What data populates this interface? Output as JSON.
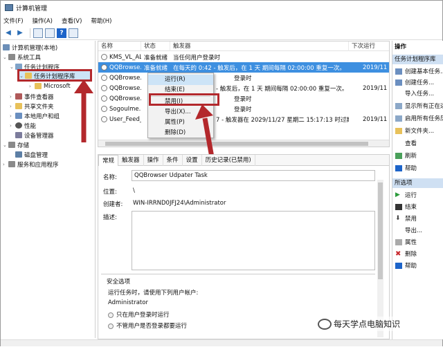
{
  "window": {
    "title": "计算机管理"
  },
  "menu": [
    "文件(F)",
    "操作(A)",
    "查看(V)",
    "帮助(H)"
  ],
  "tree": {
    "root": "计算机管理(本地)",
    "system_tools": "系统工具",
    "task_scheduler": "任务计划程序",
    "task_library": "任务计划程序库",
    "microsoft": "Microsoft",
    "event_viewer": "事件查看器",
    "shared_folders": "共享文件夹",
    "local_users": "本地用户和组",
    "performance": "性能",
    "device_manager": "设备管理器",
    "storage": "存储",
    "disk_mgmt": "磁盘管理",
    "services": "服务和应用程序"
  },
  "list": {
    "columns": [
      "名称",
      "状态",
      "触发器",
      "下次运行"
    ],
    "rows": [
      {
        "name": "KMS_VL_ALL",
        "status": "准备就绪",
        "trigger": "当任何用户登录时",
        "next": ""
      },
      {
        "name": "QQBrowse...",
        "status": "准备就绪",
        "trigger": "在每天的 0:42 - 触发后，在 1 天 期间每隔 02:00:00 重复一次。",
        "next": "2019/11"
      },
      {
        "name": "QQBrowse...",
        "status": "",
        "trigger": "登录时",
        "next": ""
      },
      {
        "name": "QQBrowse...",
        "status": "",
        "trigger": "- 触发后，在 1 天 期间每隔 02:00:00 重复一次。",
        "next": "2019/11"
      },
      {
        "name": "QQBrowse...",
        "status": "",
        "trigger": "登录时",
        "next": ""
      },
      {
        "name": "SogouIme...",
        "status": "",
        "trigger": "登录时",
        "next": ""
      },
      {
        "name": "User_Feed_...",
        "status": "",
        "trigger": "7 - 触发器在 2029/11/27 星期二 15:17:13 时过期。",
        "next": "2019/11"
      }
    ]
  },
  "context_menu": [
    "运行(R)",
    "结束(E)",
    "禁用(I)",
    "导出(X)...",
    "属性(P)",
    "删除(D)"
  ],
  "detail": {
    "tabs": [
      "常规",
      "触发器",
      "操作",
      "条件",
      "设置",
      "历史记录(已禁用)"
    ],
    "name_label": "名称:",
    "name_value": "QQBrowser Udpater Task",
    "location_label": "位置:",
    "location_value": "\\",
    "author_label": "创建者:",
    "author_value": "WIN-IRRND0JFJ24\\Administrator",
    "desc_label": "描述:",
    "security_title": "安全选项",
    "run_as_label": "运行任务时，请使用下列用户帐户:",
    "run_as_value": "Administrator",
    "radio1": "只在用户登录时运行",
    "radio2": "不管用户是否登录都要运行"
  },
  "actions": {
    "header": "操作",
    "section1": "任务计划程序库",
    "items1": [
      "创建基本任务...",
      "创建任务...",
      "导入任务...",
      "显示所有正在运行的任务",
      "启用所有任务历史记录",
      "新文件夹...",
      "查看",
      "刷新",
      "帮助"
    ],
    "section2": "所选项",
    "items2": [
      "运行",
      "结束",
      "禁用",
      "导出...",
      "属性",
      "删除",
      "帮助"
    ]
  },
  "watermark": "每天学点电脑知识",
  "colors": {
    "selection": "#3d8fe0",
    "callout": "#b3282c",
    "actions_header": "#cfe0f3"
  }
}
